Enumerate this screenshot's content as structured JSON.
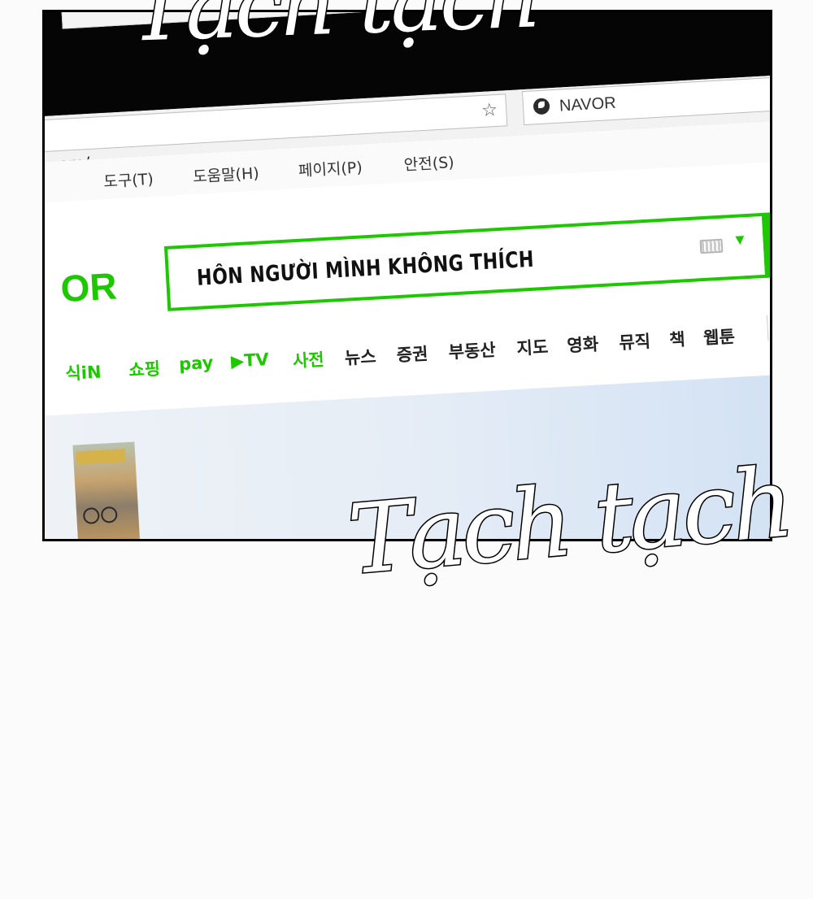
{
  "browser": {
    "url_fragment": "om/",
    "search_engine_label": "NAVOR",
    "menu": [
      "도구(T)",
      "도움말(H)",
      "페이지(P)",
      "안전(S)"
    ]
  },
  "page": {
    "logo_fragment": "OR",
    "search_query": "HÔN NGƯỜI MÌNH KHÔNG THÍCH",
    "nav_green": [
      "식iN",
      "쇼핑",
      "pay",
      "▶TV",
      "사전"
    ],
    "nav_dark": [
      "뉴스",
      "증권",
      "부동산",
      "지도",
      "영화",
      "뮤직",
      "책",
      "웹툰"
    ],
    "nav_more_fragment": "더"
  },
  "sfx": {
    "top": "Tạch tạch",
    "bottom": "Tạch tạch"
  },
  "colors": {
    "brand_green": "#1ec800",
    "bezel": "#050505"
  }
}
